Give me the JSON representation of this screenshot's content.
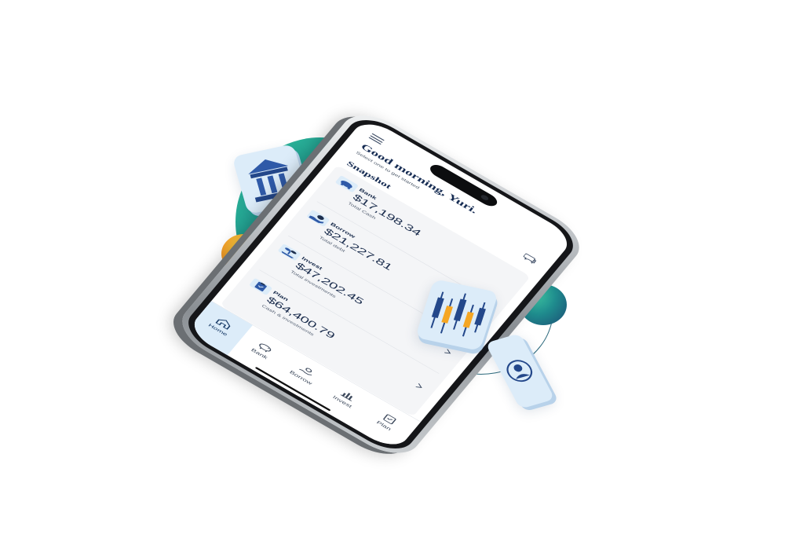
{
  "header": {
    "greeting": "Good morning, Yuri.",
    "subtext": "Select one to get started"
  },
  "snapshot": {
    "title": "Snapshot",
    "accounts": [
      {
        "label": "Bank",
        "amount": "$17,198.34",
        "sublabel": "Total Cash",
        "icon": "piggy-bank-icon"
      },
      {
        "label": "Borrow",
        "amount": "$21,227.81",
        "sublabel": "Total debt",
        "icon": "hand-coin-icon"
      },
      {
        "label": "Invest",
        "amount": "$47,202.45",
        "sublabel": "Total investments",
        "icon": "growth-plant-icon"
      },
      {
        "label": "Plan",
        "amount": "$64,400.79",
        "sublabel": "Cash & investments",
        "icon": "clipboard-icon"
      }
    ]
  },
  "tabbar": {
    "active": "Home",
    "tabs": [
      {
        "label": "Home",
        "icon": "home-icon"
      },
      {
        "label": "Bank",
        "icon": "piggy-bank-icon"
      },
      {
        "label": "Borrow",
        "icon": "hand-coin-icon"
      },
      {
        "label": "Invest",
        "icon": "bar-chart-icon"
      },
      {
        "label": "Plan",
        "icon": "clipboard-check-icon"
      }
    ]
  },
  "colors": {
    "navy": "#152b52",
    "accent_light": "#dcecf9",
    "teal": "#1f8d8e",
    "green": "#33c79e",
    "coin_orange": "#f59b25"
  }
}
